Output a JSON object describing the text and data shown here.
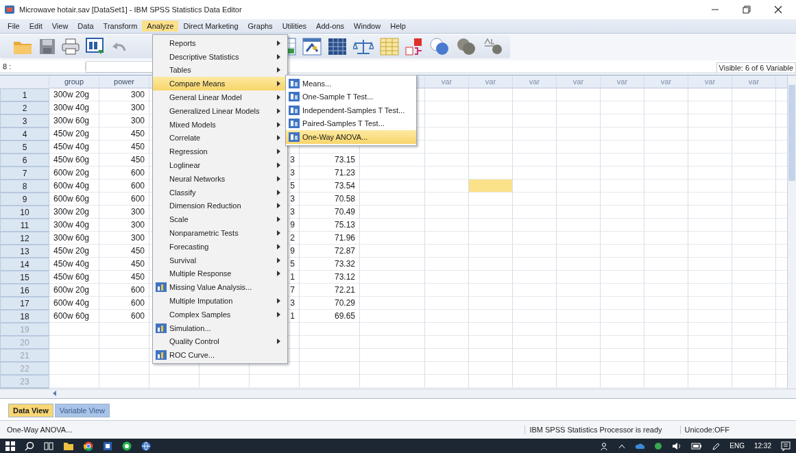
{
  "window": {
    "title": "Microwave hotair.sav [DataSet1] - IBM SPSS Statistics Data Editor"
  },
  "menubar": [
    {
      "label": "File",
      "selected": false
    },
    {
      "label": "Edit",
      "selected": false
    },
    {
      "label": "View",
      "selected": false
    },
    {
      "label": "Data",
      "selected": false
    },
    {
      "label": "Transform",
      "selected": false
    },
    {
      "label": "Analyze",
      "selected": true
    },
    {
      "label": "Direct Marketing",
      "selected": false
    },
    {
      "label": "Graphs",
      "selected": false
    },
    {
      "label": "Utilities",
      "selected": false
    },
    {
      "label": "Add-ons",
      "selected": false
    },
    {
      "label": "Window",
      "selected": false
    },
    {
      "label": "Help",
      "selected": false
    }
  ],
  "analyze_menu": [
    {
      "label": "Reports",
      "kind": "submenu",
      "selected": false
    },
    {
      "label": "Descriptive Statistics",
      "kind": "submenu",
      "selected": false
    },
    {
      "label": "Tables",
      "kind": "submenu",
      "selected": false
    },
    {
      "label": "Compare Means",
      "kind": "submenu",
      "selected": true
    },
    {
      "label": "General Linear Model",
      "kind": "submenu",
      "selected": false
    },
    {
      "label": "Generalized Linear Models",
      "kind": "submenu",
      "selected": false
    },
    {
      "label": "Mixed Models",
      "kind": "submenu",
      "selected": false
    },
    {
      "label": "Correlate",
      "kind": "submenu",
      "selected": false
    },
    {
      "label": "Regression",
      "kind": "submenu",
      "selected": false
    },
    {
      "label": "Loglinear",
      "kind": "submenu",
      "selected": false
    },
    {
      "label": "Neural Networks",
      "kind": "submenu",
      "selected": false
    },
    {
      "label": "Classify",
      "kind": "submenu",
      "selected": false
    },
    {
      "label": "Dimension Reduction",
      "kind": "submenu",
      "selected": false
    },
    {
      "label": "Scale",
      "kind": "submenu",
      "selected": false
    },
    {
      "label": "Nonparametric Tests",
      "kind": "submenu",
      "selected": false
    },
    {
      "label": "Forecasting",
      "kind": "submenu",
      "selected": false
    },
    {
      "label": "Survival",
      "kind": "submenu",
      "selected": false
    },
    {
      "label": "Multiple Response",
      "kind": "submenu",
      "selected": false
    },
    {
      "label": "Missing Value Analysis...",
      "kind": "dialog",
      "selected": false
    },
    {
      "label": "Multiple Imputation",
      "kind": "submenu",
      "selected": false
    },
    {
      "label": "Complex Samples",
      "kind": "submenu",
      "selected": false
    },
    {
      "label": "Simulation...",
      "kind": "dialog",
      "selected": false
    },
    {
      "label": "Quality Control",
      "kind": "submenu",
      "selected": false
    },
    {
      "label": "ROC Curve...",
      "kind": "dialog",
      "selected": false
    }
  ],
  "compare_means_menu": [
    {
      "label": "Means...",
      "selected": false
    },
    {
      "label": "One-Sample T Test...",
      "selected": false
    },
    {
      "label": "Independent-Samples T Test...",
      "selected": false
    },
    {
      "label": "Paired-Samples T Test...",
      "selected": false
    },
    {
      "label": "One-Way ANOVA...",
      "selected": true
    }
  ],
  "cell_editor": {
    "cell": "8 :"
  },
  "visible_info": "Visible: 6 of 6 Variable",
  "table": {
    "headers": [
      "group",
      "power"
    ],
    "var_columns": [
      {
        "label": "var",
        "selected": false
      },
      {
        "label": "var",
        "selected": true
      },
      {
        "label": "var",
        "selected": false
      },
      {
        "label": "var",
        "selected": false
      },
      {
        "label": "var",
        "selected": false
      },
      {
        "label": "var",
        "selected": false
      },
      {
        "label": "var",
        "selected": false
      },
      {
        "label": "var",
        "selected": false
      }
    ],
    "rows": [
      {
        "number": "1",
        "group": "300w 20g",
        "power": "300",
        "selected": false
      },
      {
        "number": "2",
        "group": "300w 40g",
        "power": "300",
        "selected": false
      },
      {
        "number": "3",
        "group": "300w 60g",
        "power": "300",
        "selected": false
      },
      {
        "number": "4",
        "group": "450w 20g",
        "power": "450",
        "selected": false
      },
      {
        "number": "5",
        "group": "450w 40g",
        "power": "450",
        "selected": false
      },
      {
        "number": "6",
        "group": "450w 60g",
        "power": "450",
        "column_5": "3",
        "column_6": "73.15",
        "selected": false
      },
      {
        "number": "7",
        "group": "600w 20g",
        "power": "600",
        "column_5": "3",
        "column_6": "71.23",
        "selected": false
      },
      {
        "number": "8",
        "group": "600w 40g",
        "power": "600",
        "column_5": "5",
        "column_6": "73.54",
        "selected": true
      },
      {
        "number": "9",
        "group": "600w 60g",
        "power": "600",
        "column_5": "3",
        "column_6": "70.58",
        "selected": false
      },
      {
        "number": "10",
        "group": "300w 20g",
        "power": "300",
        "column_5": "3",
        "column_6": "70.49",
        "selected": false
      },
      {
        "number": "11",
        "group": "300w 40g",
        "power": "300",
        "column_5": "9",
        "column_6": "75.13",
        "selected": false
      },
      {
        "number": "12",
        "group": "300w 60g",
        "power": "300",
        "column_5": "2",
        "column_6": "71.96",
        "selected": false
      },
      {
        "number": "13",
        "group": "450w 20g",
        "power": "450",
        "column_5": "9",
        "column_6": "72.87",
        "selected": false
      },
      {
        "number": "14",
        "group": "450w 40g",
        "power": "450",
        "column_5": "5",
        "column_6": "73.32",
        "selected": false
      },
      {
        "number": "15",
        "group": "450w 60g",
        "power": "450",
        "column_5": "1",
        "column_6": "73.12",
        "selected": false
      },
      {
        "number": "16",
        "group": "600w 20g",
        "power": "600",
        "column_5": "7",
        "column_6": "72.21",
        "selected": false
      },
      {
        "number": "17",
        "group": "600w 40g",
        "power": "600",
        "column_5": "3",
        "column_6": "70.29",
        "selected": false
      },
      {
        "number": "18",
        "group": "600w 60g",
        "power": "600",
        "column_5": "1",
        "column_6": "69.65",
        "selected": false
      },
      {
        "number": "19",
        "selected": false
      },
      {
        "number": "20",
        "selected": false
      },
      {
        "number": "21",
        "selected": false
      },
      {
        "number": "22",
        "selected": false
      },
      {
        "number": "23",
        "selected": false
      }
    ]
  },
  "view_tabs": [
    {
      "label": "Data View",
      "selected": true
    },
    {
      "label": "Variable View",
      "selected": false
    }
  ],
  "status_bar": {
    "message": "One-Way ANOVA...",
    "processor": "IBM SPSS Statistics Processor is ready",
    "unicode": "Unicode:OFF"
  },
  "taskbar": {
    "language": "ENG",
    "time": "12:32"
  }
}
